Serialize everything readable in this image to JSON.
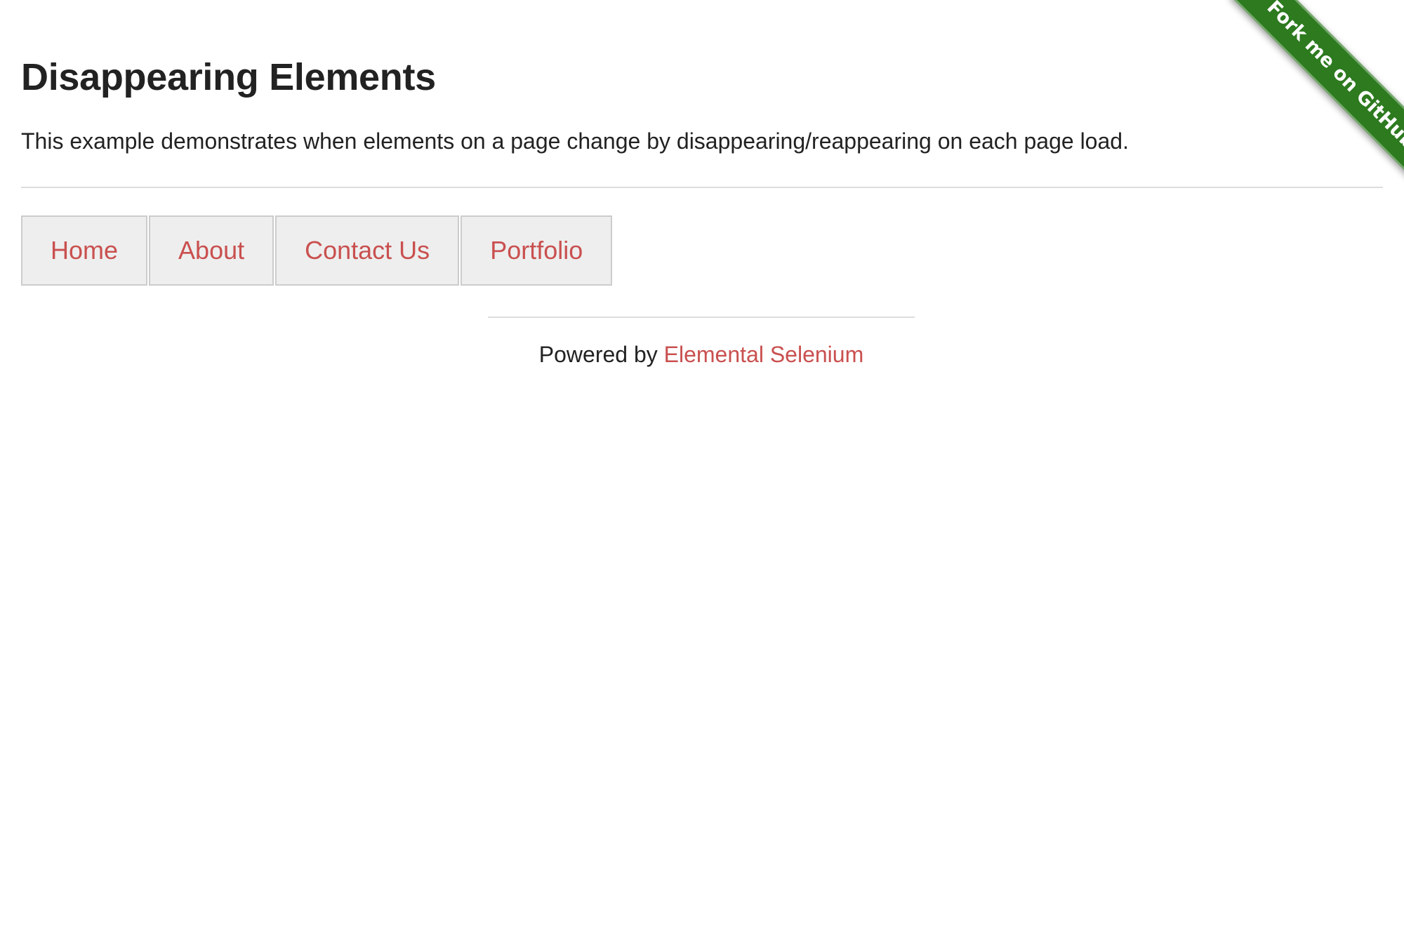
{
  "page": {
    "title": "Disappearing Elements",
    "description": "This example demonstrates when elements on a page change by disappearing/reappearing on each page load."
  },
  "menu": {
    "items": [
      {
        "label": "Home"
      },
      {
        "label": "About"
      },
      {
        "label": "Contact Us"
      },
      {
        "label": "Portfolio"
      }
    ]
  },
  "footer": {
    "prefix": "Powered by ",
    "link_label": "Elemental Selenium"
  },
  "ribbon": {
    "label": "Fork me on GitHub",
    "color": "#2d7a1f"
  },
  "colors": {
    "link": "#c9504f",
    "text": "#222222",
    "menu_background": "#eeeeee",
    "menu_border": "#cccccc"
  }
}
